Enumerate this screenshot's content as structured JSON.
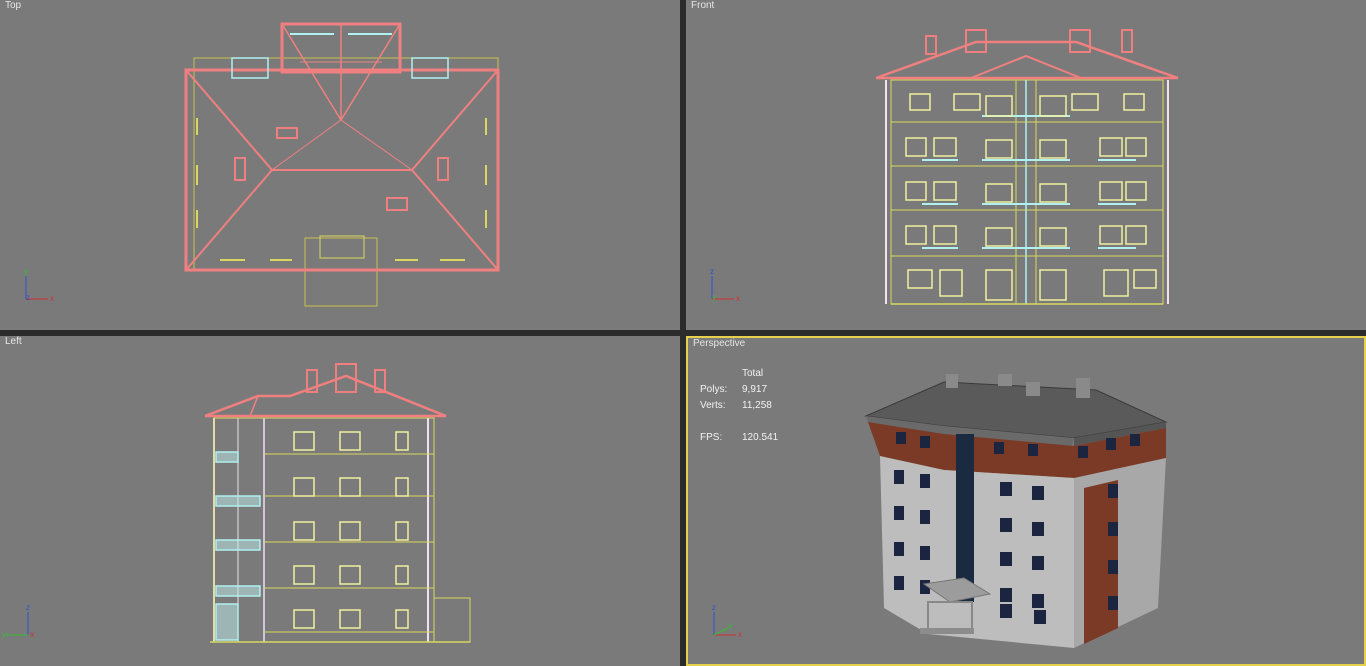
{
  "viewports": {
    "top": {
      "label": "Top"
    },
    "front": {
      "label": "Front"
    },
    "left": {
      "label": "Left"
    },
    "perspective": {
      "label": "Perspective"
    }
  },
  "stats": {
    "header": "Total",
    "polys_label": "Polys:",
    "polys_value": "9,917",
    "verts_label": "Verts:",
    "verts_value": "11,258",
    "fps_label": "FPS:",
    "fps_value": "120.541"
  },
  "axis": {
    "x": "x",
    "y": "y",
    "z": "z"
  },
  "colors": {
    "viewport_bg": "#7a7a7a",
    "active_border": "#e6d24a",
    "roof_wire": "#f08080",
    "body_wire": "#d8d860",
    "glass_wire": "#b0f0f0",
    "frame_wire": "#f0e0f0"
  }
}
